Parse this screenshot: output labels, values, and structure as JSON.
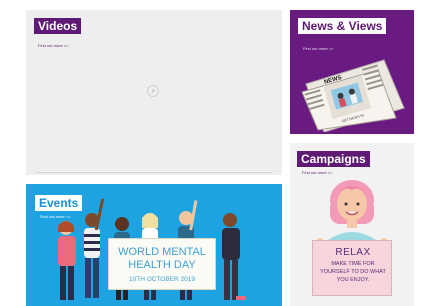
{
  "tiles": {
    "videos": {
      "label": "Videos",
      "link": "Find out more >>"
    },
    "news": {
      "label": "News & Views",
      "link": "Find out more >>",
      "newspaper_masthead": "NEWS",
      "newspaper_caption": "GET NEWS IN"
    },
    "campaigns": {
      "label": "Campaigns",
      "link": "Find out more >>"
    },
    "events": {
      "label": "Events",
      "link": "Find out more >>"
    }
  },
  "relax_sign": {
    "title": "RELAX",
    "line1": "MAKE TIME FOR",
    "line2": "YOURSELF TO DO WHAT",
    "line3": "YOU ENJOY."
  },
  "event_sign": {
    "line1": "WORLD MENTAL",
    "line2": "HEALTH DAY",
    "date": "10TH OCTOBER 2019"
  },
  "colors": {
    "brand_purple": "#5e1a74",
    "news_bg": "#6a1b82",
    "events_bg": "#1da2e2",
    "video_bg": "#eeeeee"
  }
}
